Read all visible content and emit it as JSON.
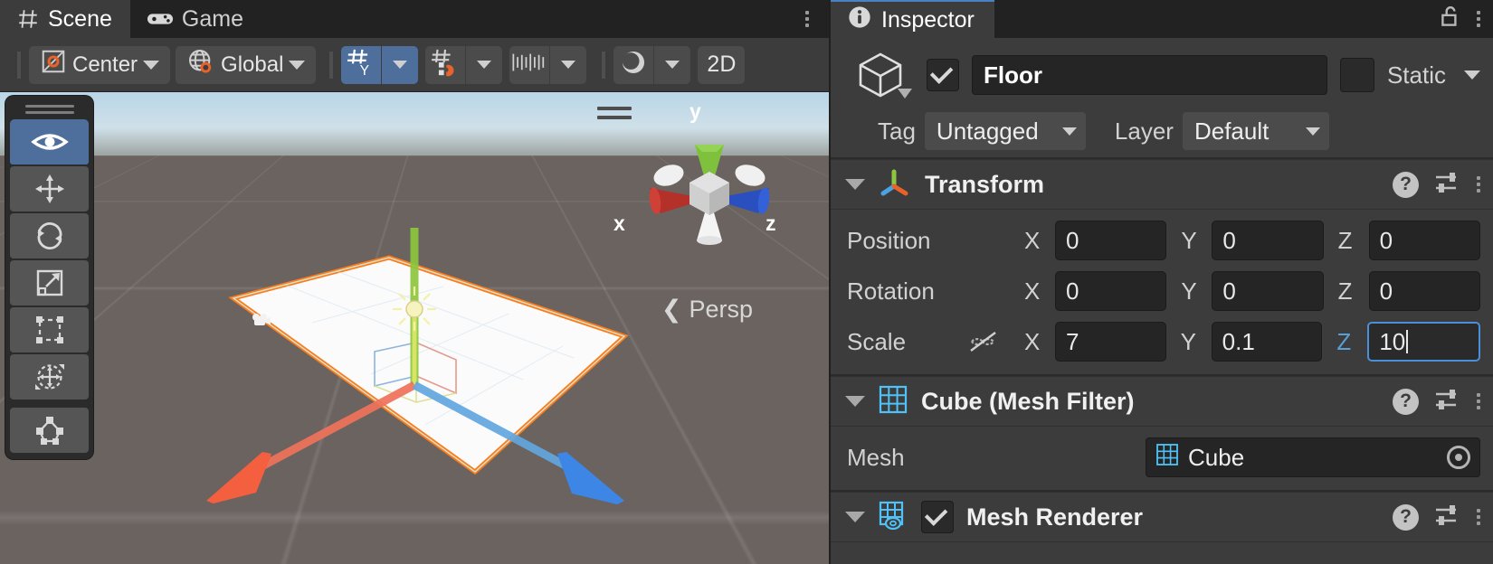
{
  "scene_panel": {
    "tabs": [
      {
        "label": "Scene",
        "icon": "grid-icon",
        "active": true
      },
      {
        "label": "Game",
        "icon": "gamepad-icon",
        "active": false
      }
    ],
    "overflow_menu": "kebab-menu",
    "toolbar": {
      "pivot": {
        "label": "Center",
        "icon": "pivot-center-icon",
        "caret": "▾"
      },
      "handle_space": {
        "label": "Global",
        "icon": "globe-icon",
        "caret": "▾"
      },
      "grid_snap": {
        "icon": "grid-axis-y-icon",
        "active": true
      },
      "magnet_snap": {
        "icon": "grid-magnet-icon",
        "active": false
      },
      "grid_size": {
        "icon": "grid-ruler-icon",
        "active": false
      },
      "lighting": {
        "icon": "lighting-sphere-icon",
        "active": false
      },
      "mode_2d": "2D"
    },
    "tool_palette": [
      {
        "name": "view-tool",
        "icon": "eye-icon",
        "selected": true
      },
      {
        "name": "move-tool",
        "icon": "move-arrows-icon",
        "selected": false
      },
      {
        "name": "rotate-tool",
        "icon": "rotate-icon",
        "selected": false
      },
      {
        "name": "scale-tool",
        "icon": "scale-icon",
        "selected": false
      },
      {
        "name": "rect-tool",
        "icon": "rect-transform-icon",
        "selected": false
      },
      {
        "name": "transform-tool",
        "icon": "transform-icon",
        "selected": false
      },
      {
        "name": "custom-editor-tool",
        "icon": "custom-tool-icon",
        "selected": false
      }
    ],
    "viewport": {
      "camera_mode": "Persp",
      "camera_mode_prefix": "❮",
      "gizmo_axes": {
        "x": "x",
        "y": "y",
        "z": "z"
      },
      "selected_object_outline": "#ff7a18"
    }
  },
  "inspector": {
    "tab": {
      "label": "Inspector",
      "icon": "info-icon"
    },
    "lock_icon": "unlocked-padlock-icon",
    "overflow_menu": "kebab-menu",
    "object": {
      "enabled": true,
      "icon": "cube-icon",
      "name": "Floor",
      "static_label": "Static",
      "static_checked": false,
      "static_caret": "▾",
      "tag_label": "Tag",
      "tag_value": "Untagged",
      "layer_label": "Layer",
      "layer_value": "Default",
      "caret": "▾"
    },
    "components": [
      {
        "title": "Transform",
        "icon": "transform-axis-icon",
        "expanded": true,
        "has_enable_toggle": false,
        "rows": [
          {
            "label": "Position",
            "fields": [
              {
                "axis": "X",
                "value": "0",
                "focused": false
              },
              {
                "axis": "Y",
                "value": "0",
                "focused": false
              },
              {
                "axis": "Z",
                "value": "0",
                "focused": false
              }
            ]
          },
          {
            "label": "Rotation",
            "fields": [
              {
                "axis": "X",
                "value": "0",
                "focused": false
              },
              {
                "axis": "Y",
                "value": "0",
                "focused": false
              },
              {
                "axis": "Z",
                "value": "0",
                "focused": false
              }
            ]
          },
          {
            "label": "Scale",
            "lock_icon": "constrain-proportions-off-icon",
            "fields": [
              {
                "axis": "X",
                "value": "7",
                "focused": false
              },
              {
                "axis": "Y",
                "value": "0.1",
                "focused": false
              },
              {
                "axis": "Z",
                "value": "10",
                "focused": true
              }
            ]
          }
        ]
      },
      {
        "title": "Cube (Mesh Filter)",
        "icon": "mesh-filter-icon",
        "expanded": true,
        "has_enable_toggle": false,
        "mesh_label": "Mesh",
        "mesh_value": "Cube",
        "mesh_value_icon": "mesh-icon"
      },
      {
        "title": "Mesh Renderer",
        "icon": "mesh-renderer-icon",
        "expanded": true,
        "has_enable_toggle": true,
        "enabled": true
      }
    ],
    "component_tools": {
      "help": "?",
      "preset": "preset-icon",
      "menu": "kebab-menu"
    }
  },
  "colors": {
    "accent_blue": "#4a90d9",
    "selection_orange": "#ff7a18",
    "tab_active_bg": "#3c3c3c",
    "panel_bg": "#3c3c3c",
    "field_bg": "#252525",
    "axis_x": "#e5503a",
    "axis_y": "#8ec63f",
    "axis_z": "#3b7fd4"
  }
}
